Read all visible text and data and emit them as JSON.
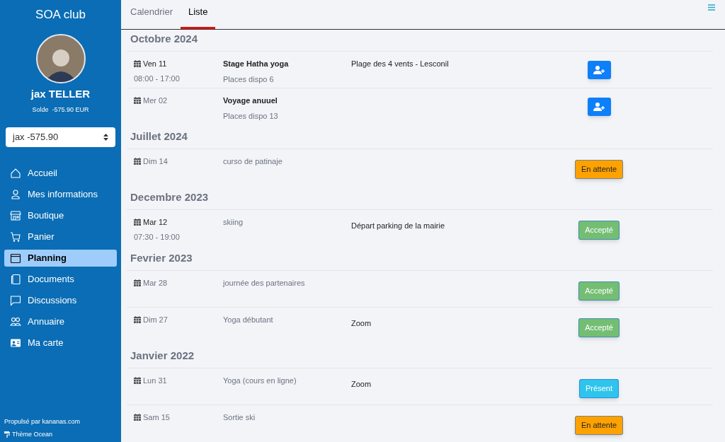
{
  "sidebar": {
    "club_name": "SOA club",
    "user_name": "jax TELLER",
    "balance_label": "Solde",
    "balance": "-575.90 EUR",
    "account_select": "jax -575.90",
    "items": [
      {
        "label": "Accueil",
        "selected": false
      },
      {
        "label": "Mes informations",
        "selected": false
      },
      {
        "label": "Boutique",
        "selected": false
      },
      {
        "label": "Panier",
        "selected": false
      },
      {
        "label": "Planning",
        "selected": true
      },
      {
        "label": "Documents",
        "selected": false
      },
      {
        "label": "Discussions",
        "selected": false
      },
      {
        "label": "Annuaire",
        "selected": false
      },
      {
        "label": "Ma carte",
        "selected": false
      }
    ],
    "footer": "Propulsé par kananas.com",
    "theme": "Thème Ocean"
  },
  "tabs": [
    {
      "label": "Calendrier",
      "selected": false
    },
    {
      "label": "Liste",
      "selected": true
    }
  ],
  "groups": [
    {
      "month": "Octobre 2024",
      "events": [
        {
          "date": "Ven 11",
          "time": "08:00 - 17:00",
          "title": "Stage Hatha yoga",
          "bold": true,
          "places": "Places dispo 6",
          "location": "Plage des 4 vents - Lesconil",
          "action": {
            "kind": "join"
          }
        },
        {
          "date": "Mer 02",
          "title": "Voyage anuuel",
          "bold": true,
          "places": "Places dispo 13",
          "action": {
            "kind": "join"
          }
        }
      ]
    },
    {
      "month": "Juillet 2024",
      "events": [
        {
          "date": "Dim 14",
          "title": "curso de patinaje",
          "bold": false,
          "action": {
            "kind": "status",
            "label": "En attente",
            "color": "#ffa200"
          }
        }
      ]
    },
    {
      "month": "Decembre 2023",
      "events": [
        {
          "date": "Mar 12",
          "time": "07:30 - 19:00",
          "title": "skiing",
          "bold": false,
          "location": "Départ parking de la mairie",
          "action": {
            "kind": "status",
            "label": "Accepté",
            "color": "#74be74"
          }
        }
      ]
    },
    {
      "month": "Fevrier 2023",
      "events": [
        {
          "date": "Mar 28",
          "title": "journée des partenaires",
          "bold": false,
          "action": {
            "kind": "status",
            "label": "Accepté",
            "color": "#74be74"
          }
        },
        {
          "date": "Dim 27",
          "title": "Yoga débutant",
          "bold": false,
          "location": "Zoom",
          "action": {
            "kind": "status",
            "label": "Accepté",
            "color": "#74be74"
          }
        }
      ]
    },
    {
      "month": "Janvier 2022",
      "events": [
        {
          "date": "Lun 31",
          "title": "Yoga (cours en ligne)",
          "bold": false,
          "location": "Zoom",
          "action": {
            "kind": "status",
            "label": "Présent",
            "color": "#2ec4ec"
          }
        },
        {
          "date": "Sam 15",
          "title": "Sortie ski",
          "bold": false,
          "action": {
            "kind": "status",
            "label": "En attente",
            "color": "#ffa200"
          }
        }
      ]
    }
  ]
}
